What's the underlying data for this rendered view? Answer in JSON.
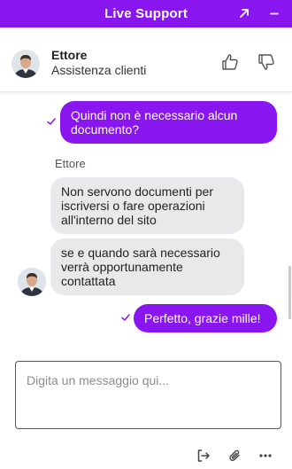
{
  "window": {
    "title": "Live Support"
  },
  "agent": {
    "name": "Ettore",
    "role": "Assistenza clienti"
  },
  "conversation": {
    "messages": [
      {
        "from": "user",
        "text": "Quindi non è necessario alcun documento?"
      },
      {
        "from": "agent",
        "sender": "Ettore",
        "text": "Non servono documenti per iscriversi o fare operazioni all'interno del sito"
      },
      {
        "from": "agent",
        "text": "se e quando sarà necessario verrà opportunamente contattata"
      },
      {
        "from": "user",
        "text": "Perfetto, grazie mille!"
      }
    ]
  },
  "composer": {
    "placeholder": "Digita un messaggio qui..."
  },
  "icons": {
    "popout": "popout-arrow-icon",
    "minimize": "minimize-icon",
    "thumb_up": "thumbs-up-icon",
    "thumb_down": "thumbs-down-icon",
    "transfer": "transfer-icon",
    "attach": "paperclip-icon",
    "more": "more-icon",
    "read": "check-icon"
  },
  "colors": {
    "accent": "#8a16ef",
    "agent_bubble": "#e9e9ec",
    "header_text": "#ffffff"
  }
}
